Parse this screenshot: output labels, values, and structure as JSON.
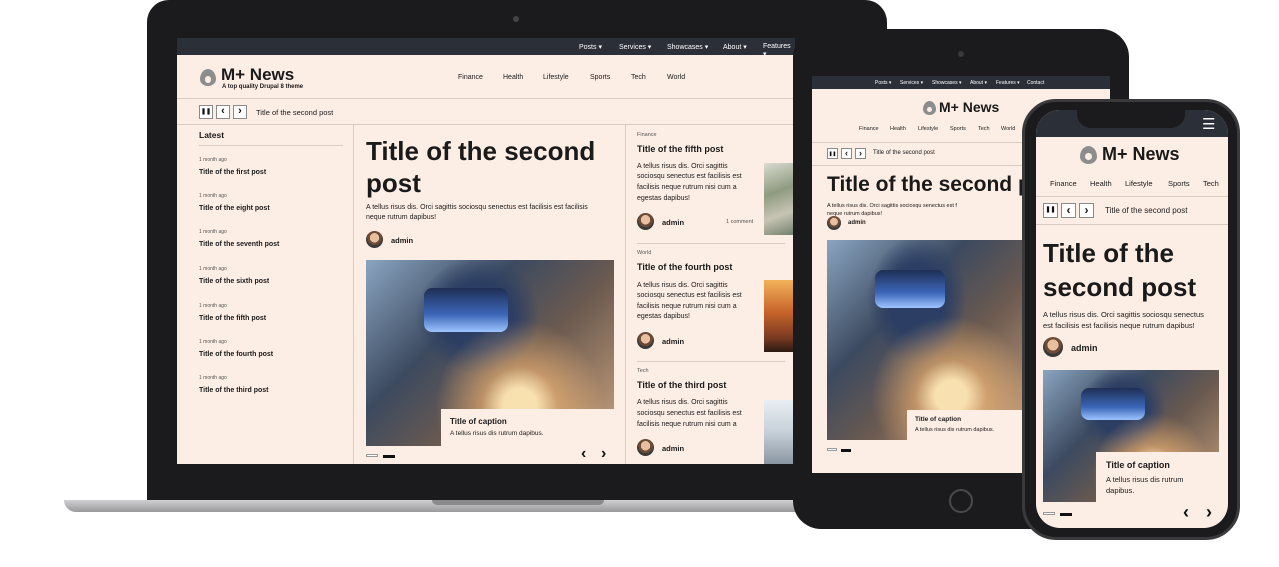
{
  "site": {
    "name": "M+ News",
    "tagline": "A top quality Drupal 8 theme",
    "top_menu": [
      "Posts",
      "Services",
      "Showcases",
      "About",
      "Features",
      "Contact"
    ],
    "categories": [
      "Finance",
      "Health",
      "Lifestyle",
      "Sports",
      "Tech",
      "World"
    ]
  },
  "ticker": {
    "current_title": "Title of the second post"
  },
  "latest": {
    "heading": "Latest",
    "items": [
      {
        "time": "1 month ago",
        "title": "Title of the first post"
      },
      {
        "time": "1 month ago",
        "title": "Title of the eight post"
      },
      {
        "time": "1 month ago",
        "title": "Title of the seventh post"
      },
      {
        "time": "1 month ago",
        "title": "Title of the sixth post"
      },
      {
        "time": "1 month ago",
        "title": "Title of the fifth post"
      },
      {
        "time": "1 month ago",
        "title": "Title of the fourth post"
      },
      {
        "time": "1 month ago",
        "title": "Title of the third post"
      }
    ]
  },
  "feature": {
    "title": "Title of the second post",
    "title_phone_l1": "Title of the",
    "title_phone_l2": "second post",
    "title_laptop_l1": "Title of the second",
    "title_laptop_l2": "post",
    "tablet_title": "Title of the second p",
    "excerpt": "A tellus risus dis. Orci sagittis sociosqu senectus est facilisis est facilisis neque rutrum dapibus!",
    "excerpt_l1": "A tellus risus dis. Orci sagittis sociosqu senectus est facilisis est facilisis",
    "excerpt_l2": "neque rutrum dapibus!",
    "tablet_excerpt": "A tellus risus dis. Orci sagittis sociosqu senectus est f",
    "tablet_excerpt2": "neque rutrum dapibus!",
    "phone_excerpt_l1": "A tellus risus dis. Orci sagittis sociosqu senectus",
    "phone_excerpt_l2": "est facilisis est facilisis neque rutrum dapibus!",
    "author": "admin",
    "caption_title": "Title of caption",
    "caption_text": "A tellus risus dis rutrum dapibus.",
    "caption_text_phone_l1": "A tellus risus dis rutrum",
    "caption_text_phone_l2": "dapibus."
  },
  "right_posts": [
    {
      "category": "Finance",
      "title": "Title of the fifth post",
      "excerpt": [
        "A tellus risus dis. Orci sagittis",
        "sociosqu senectus est facilisis est",
        "facilisis neque rutrum nisi cum a",
        "egestas dapibus!"
      ],
      "author": "admin",
      "comments": "1 comment"
    },
    {
      "category": "World",
      "title": "Title of the fourth post",
      "excerpt": [
        "A tellus risus dis. Orci sagittis",
        "sociosqu senectus est facilisis est",
        "facilisis neque rutrum nisi cum a",
        "egestas dapibus!"
      ],
      "author": "admin"
    },
    {
      "category": "Tech",
      "title": "Title of the third post",
      "excerpt": [
        "A tellus risus dis. Orci sagittis",
        "sociosqu senectus est facilisis est",
        "facilisis neque rutrum nisi cum a"
      ],
      "author": "admin"
    }
  ],
  "icons": {
    "pause": "❚❚",
    "prev": "‹",
    "next": "›",
    "menu": "☰"
  },
  "colors": {
    "accent_bg": "#fdeee5",
    "nav_bg": "#2b2f38",
    "device_body": "#1b1b1d"
  }
}
